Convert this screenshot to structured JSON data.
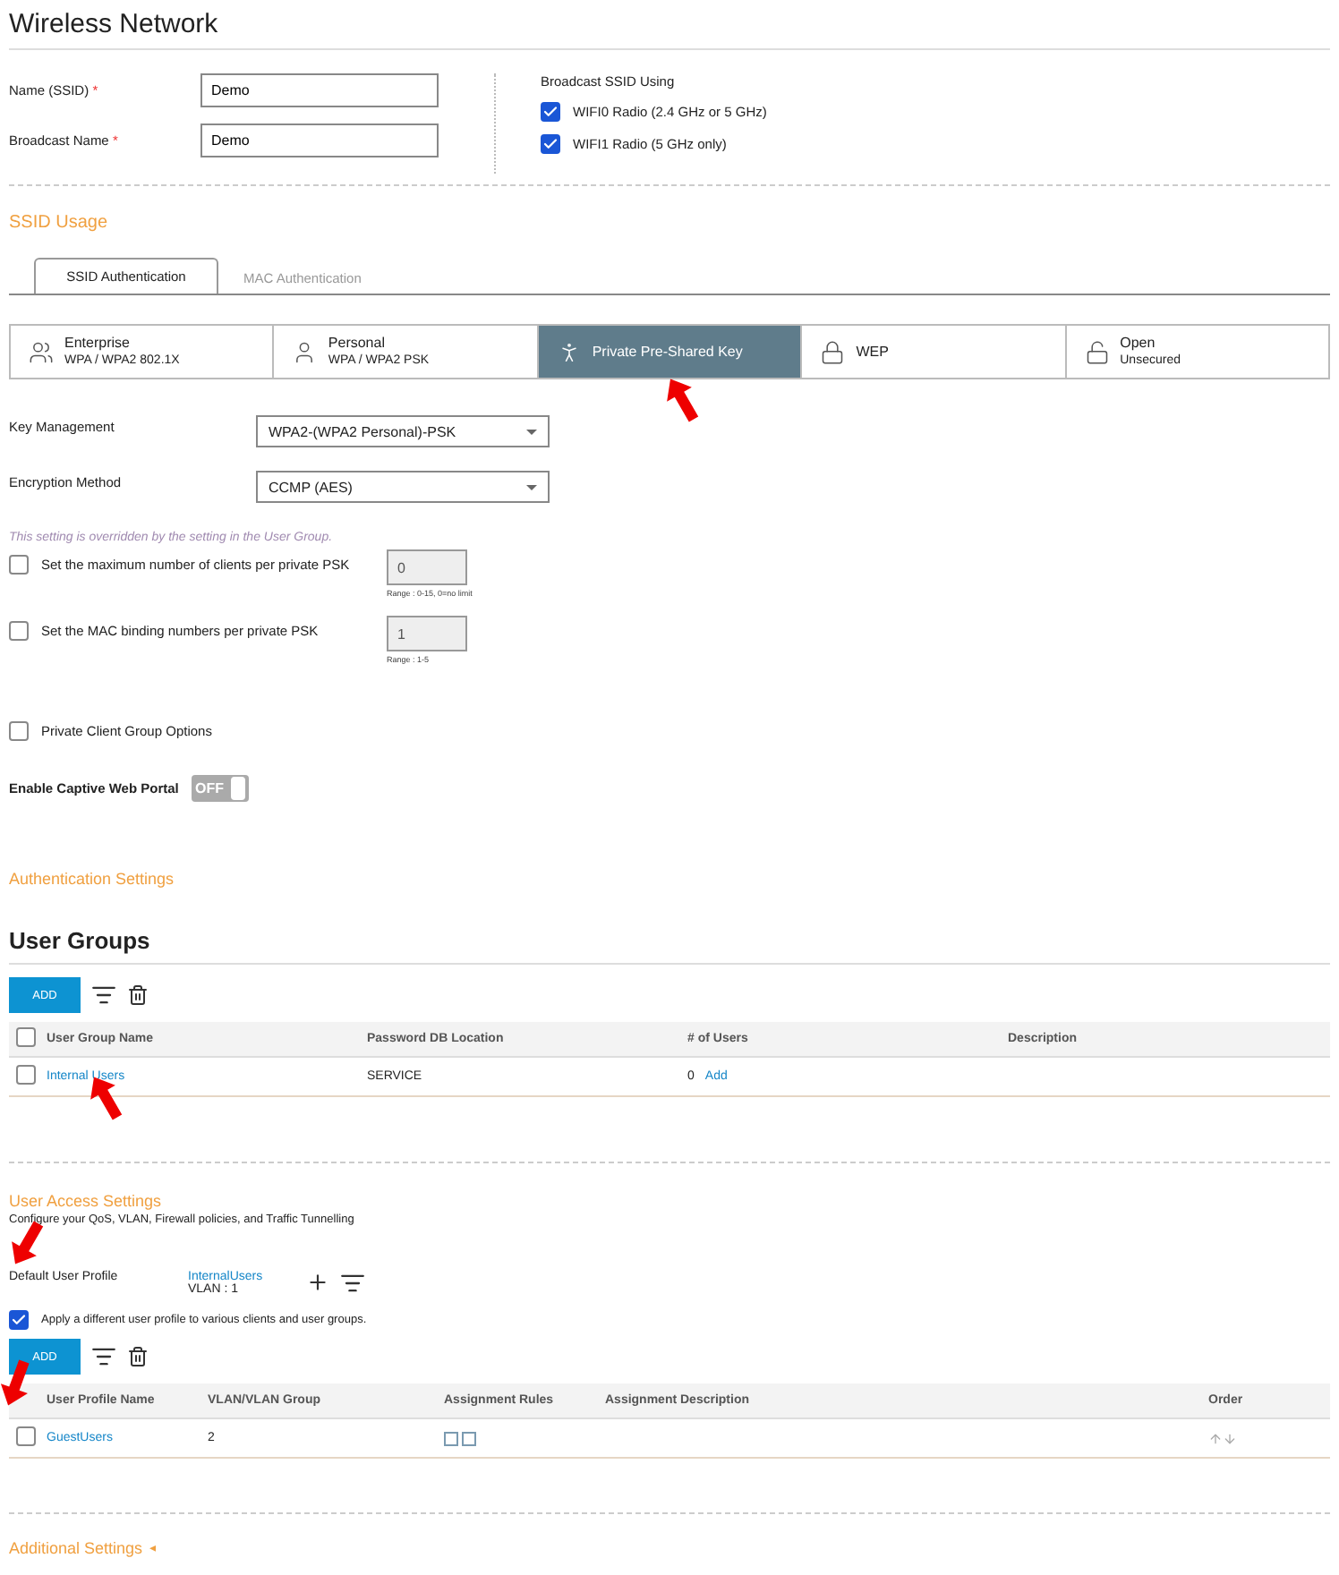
{
  "title": "Wireless Network",
  "ssid_fields": [
    {
      "label": "Name (SSID)",
      "required_mark": "*",
      "value": "Demo"
    },
    {
      "label": "Broadcast Name",
      "required_mark": "*",
      "value": "Demo"
    }
  ],
  "broadcast": {
    "label": "Broadcast SSID Using",
    "options": [
      {
        "label": "WIFI0 Radio (2.4 GHz or 5 GHz)",
        "checked": true
      },
      {
        "label": "WIFI1 Radio (5 GHz only)",
        "checked": true
      }
    ]
  },
  "ssid_usage": {
    "heading": "SSID Usage",
    "tabs": [
      {
        "label": "SSID Authentication",
        "selected": true
      },
      {
        "label": "MAC Authentication",
        "selected": false
      }
    ],
    "auth_types": [
      {
        "kind": "group",
        "label": "Enterprise",
        "sub": "WPA / WPA2 802.1X",
        "selected": false
      },
      {
        "kind": "person",
        "label": "Personal",
        "sub": "WPA / WPA2 PSK",
        "selected": false
      },
      {
        "kind": "key",
        "label": "Private Pre-Shared Key",
        "selected": true
      },
      {
        "kind": "lock",
        "label": "WEP",
        "selected": false
      },
      {
        "kind": "open",
        "label": "Open",
        "sub": "Unsecured",
        "selected": false
      }
    ],
    "selects": [
      {
        "label": "Key Management",
        "value": "WPA2-(WPA2 Personal)-PSK"
      },
      {
        "label": "Encryption Method",
        "value": "CCMP (AES)"
      }
    ],
    "note": "This setting is overridden by the setting in the User Group.",
    "limits": [
      {
        "label": "Set the maximum number of clients per private PSK",
        "checked": false,
        "value": "0",
        "range": "Range : 0-15, 0=no limit"
      },
      {
        "label": "Set the MAC binding numbers per private PSK",
        "checked": false,
        "value": "1",
        "range": "Range : 1-5"
      }
    ],
    "client_group": {
      "label": "Private Client Group Options",
      "checked": false
    },
    "captive_portal": {
      "label": "Enable Captive Web Portal",
      "on": false,
      "toggle_label": "OFF"
    }
  },
  "auth_settings": {
    "heading": "Authentication Settings"
  },
  "user_groups": {
    "heading": "User Groups",
    "add": "ADD",
    "select_all_checked": false,
    "columns": [
      "User Group Name",
      "Password DB Location",
      "# of Users",
      "Description"
    ],
    "rows": [
      {
        "name": "Internal Users",
        "location": "SERVICE",
        "users": "0",
        "add": "Add",
        "checked": false
      }
    ]
  },
  "user_access": {
    "heading": "User Access Settings",
    "subtitle": "Configure your QoS, VLAN, Firewall policies, and Traffic Tunnelling",
    "default_label": "Default User Profile",
    "default_profile": "InternalUsers",
    "default_vlan": "VLAN : 1",
    "apply": {
      "label": "Apply a different user profile to various clients and user groups.",
      "checked": true
    },
    "add": "ADD",
    "columns": [
      "User Profile Name",
      "VLAN/VLAN Group",
      "Assignment Rules",
      "Assignment Description",
      "Order"
    ],
    "rows": [
      {
        "name": "GuestUsers",
        "vlan": "2",
        "checked": false
      }
    ]
  },
  "additional": {
    "heading": "Additional Settings",
    "toggle_glyph": "◂"
  }
}
